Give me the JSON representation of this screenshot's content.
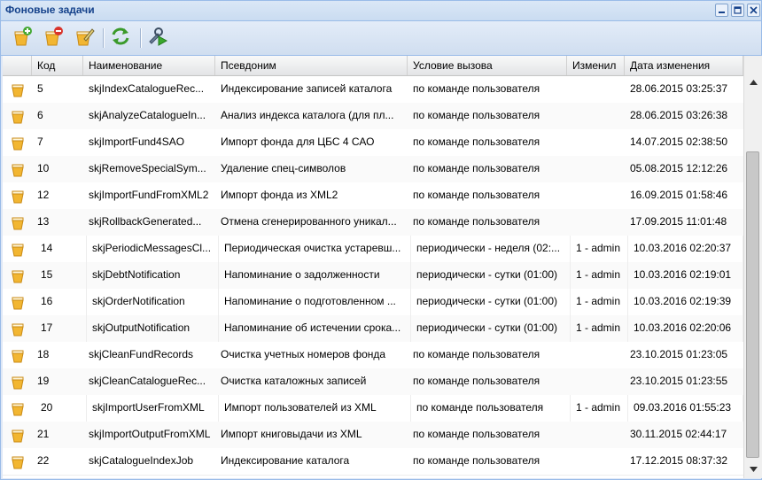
{
  "window": {
    "title": "Фоновые задачи"
  },
  "window_controls": [
    "minimize-icon",
    "maximize-icon",
    "close-icon"
  ],
  "toolbar": {
    "buttons": [
      {
        "name": "add-task-button",
        "icon": "add-task-icon"
      },
      {
        "name": "delete-task-button",
        "icon": "delete-task-icon"
      },
      {
        "name": "edit-task-button",
        "icon": "edit-task-icon"
      },
      {
        "name": "refresh-button",
        "icon": "refresh-icon"
      },
      {
        "name": "run-task-button",
        "icon": "run-task-icon"
      }
    ]
  },
  "table": {
    "columns": [
      "",
      "Код",
      "Наименование",
      "Псевдоним",
      "Условие вызова",
      "Изменил",
      "Дата изменения"
    ],
    "rows": [
      {
        "code": "5",
        "name": "skjIndexCatalogueRec...",
        "alias": "Индексирование записей каталога",
        "condition": "по команде пользователя",
        "changed_by": "",
        "date": "28.06.2015 03:25:37",
        "shift": false
      },
      {
        "code": "6",
        "name": "skjAnalyzeCatalogueIn...",
        "alias": "Анализ индекса каталога (для пл...",
        "condition": "по команде пользователя",
        "changed_by": "",
        "date": "28.06.2015 03:26:38",
        "shift": false
      },
      {
        "code": "7",
        "name": "skjImportFund4SAO",
        "alias": "Импорт фонда для ЦБС 4 САО",
        "condition": "по команде пользователя",
        "changed_by": "",
        "date": "14.07.2015 02:38:50",
        "shift": false
      },
      {
        "code": "10",
        "name": "skjRemoveSpecialSym...",
        "alias": "Удаление спец-символов",
        "condition": "по команде пользователя",
        "changed_by": "",
        "date": "05.08.2015 12:12:26",
        "shift": false
      },
      {
        "code": "12",
        "name": "skjImportFundFromXML2",
        "alias": "Импорт фонда из XML2",
        "condition": "по команде пользователя",
        "changed_by": "",
        "date": "16.09.2015 01:58:46",
        "shift": false
      },
      {
        "code": "13",
        "name": "skjRollbackGenerated...",
        "alias": "Отмена сгенерированного уникал...",
        "condition": "по команде пользователя",
        "changed_by": "",
        "date": "17.09.2015 11:01:48",
        "shift": false
      },
      {
        "code": "14",
        "name": "skjPeriodicMessagesCl...",
        "alias": "Периодическая очистка устаревш...",
        "condition": "периодически - неделя (02:...",
        "changed_by": "1 - admin",
        "date": "10.03.2016 02:20:37",
        "shift": true
      },
      {
        "code": "15",
        "name": "skjDebtNotification",
        "alias": "Напоминание о задолженности",
        "condition": "периодически - сутки (01:00)",
        "changed_by": "1 - admin",
        "date": "10.03.2016 02:19:01",
        "shift": true
      },
      {
        "code": "16",
        "name": "skjOrderNotification",
        "alias": "Напоминание о подготовленном ...",
        "condition": "периодически - сутки (01:00)",
        "changed_by": "1 - admin",
        "date": "10.03.2016 02:19:39",
        "shift": true
      },
      {
        "code": "17",
        "name": "skjOutputNotification",
        "alias": "Напоминание об истечении срока...",
        "condition": "периодически - сутки (01:00)",
        "changed_by": "1 - admin",
        "date": "10.03.2016 02:20:06",
        "shift": true
      },
      {
        "code": "18",
        "name": "skjCleanFundRecords",
        "alias": "Очистка учетных номеров фонда",
        "condition": "по команде пользователя",
        "changed_by": "",
        "date": "23.10.2015 01:23:05",
        "shift": false
      },
      {
        "code": "19",
        "name": "skjCleanCatalogueRec...",
        "alias": "Очистка каталожных записей",
        "condition": "по команде пользователя",
        "changed_by": "",
        "date": "23.10.2015 01:23:55",
        "shift": false
      },
      {
        "code": "20",
        "name": "skjImportUserFromXML",
        "alias": "Импорт пользователей из XML",
        "condition": "по команде пользователя",
        "changed_by": "1 - admin",
        "date": "09.03.2016 01:55:23",
        "shift": true
      },
      {
        "code": "21",
        "name": "skjImportOutputFromXML",
        "alias": "Импорт книговыдачи из XML",
        "condition": "по команде пользователя",
        "changed_by": "",
        "date": "30.11.2015 02:44:17",
        "shift": false
      },
      {
        "code": "22",
        "name": "skjCatalogueIndexJob",
        "alias": "Индексирование каталога",
        "condition": "по команде пользователя",
        "changed_by": "",
        "date": "17.12.2015 08:37:32",
        "shift": false
      }
    ]
  },
  "colors": {
    "title": "#15428b",
    "border": "#99bbe8",
    "header_bg": "#dfe8f6"
  }
}
